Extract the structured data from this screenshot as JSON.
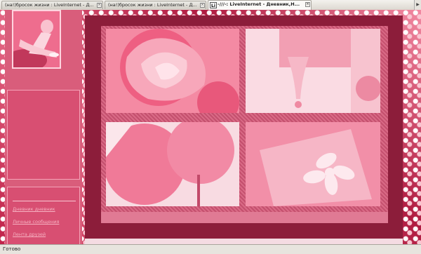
{
  "tabs": [
    {
      "label": "(на!)бросок жизни : LiveInternet - Д...",
      "active": false
    },
    {
      "label": "(на!)бросок жизни : LiveInternet - Д...",
      "active": false
    },
    {
      "label": "-///-: LiveInternet - Дневник,Н...",
      "active": true
    }
  ],
  "tab_icon_text": "Li",
  "sidebar": {
    "links": [
      "Дневник дневник",
      "Личные сообщения",
      "Лента друзей",
      "..."
    ]
  },
  "status": {
    "text": "Готово"
  },
  "colors": {
    "accent": "#8c1d3a",
    "sidebar": "#d95d7b",
    "frame": "#d96a86"
  }
}
